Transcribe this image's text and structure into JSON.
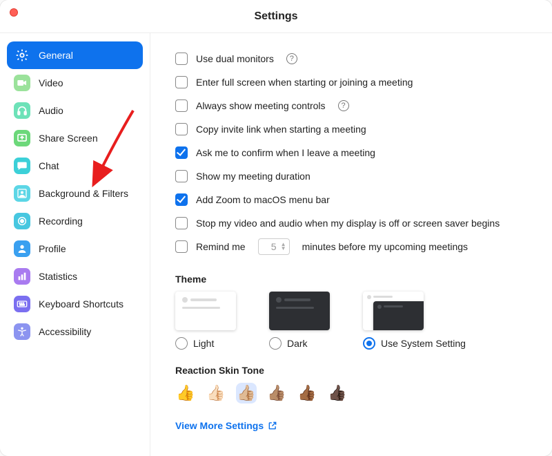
{
  "window": {
    "title": "Settings"
  },
  "sidebar": {
    "items": [
      {
        "label": "General"
      },
      {
        "label": "Video"
      },
      {
        "label": "Audio"
      },
      {
        "label": "Share Screen"
      },
      {
        "label": "Chat"
      },
      {
        "label": "Background & Filters"
      },
      {
        "label": "Recording"
      },
      {
        "label": "Profile"
      },
      {
        "label": "Statistics"
      },
      {
        "label": "Keyboard Shortcuts"
      },
      {
        "label": "Accessibility"
      }
    ]
  },
  "opts": {
    "dual": "Use dual monitors",
    "fullscreen": "Enter full screen when starting or joining a meeting",
    "controls": "Always show meeting controls",
    "copylink": "Copy invite link when starting a meeting",
    "confirm": "Ask me to confirm when I leave a meeting",
    "duration": "Show my meeting duration",
    "menubar": "Add Zoom to macOS menu bar",
    "stopvideo": "Stop my video and audio when my display is off or screen saver begins",
    "remind_a": "Remind me",
    "remind_val": "5",
    "remind_b": "minutes before my upcoming meetings"
  },
  "sections": {
    "theme": "Theme",
    "skin": "Reaction Skin Tone"
  },
  "themes": {
    "light": "Light",
    "dark": "Dark",
    "system": "Use System Setting"
  },
  "tones": [
    "👍",
    "👍🏻",
    "👍🏼",
    "👍🏽",
    "👍🏾",
    "👍🏿"
  ],
  "footer": {
    "more": "View More Settings"
  },
  "colors": {
    "general": "#ffffff",
    "video": "#9be29b",
    "audio": "#6de2b8",
    "share": "#6cd87a",
    "chat": "#3cd0d8",
    "bg": "#5cd6e6",
    "rec": "#47c7e0",
    "profile": "#3aa0f0",
    "stats": "#a97bf0",
    "keys": "#7b6ff0",
    "acc": "#8c94f0"
  }
}
